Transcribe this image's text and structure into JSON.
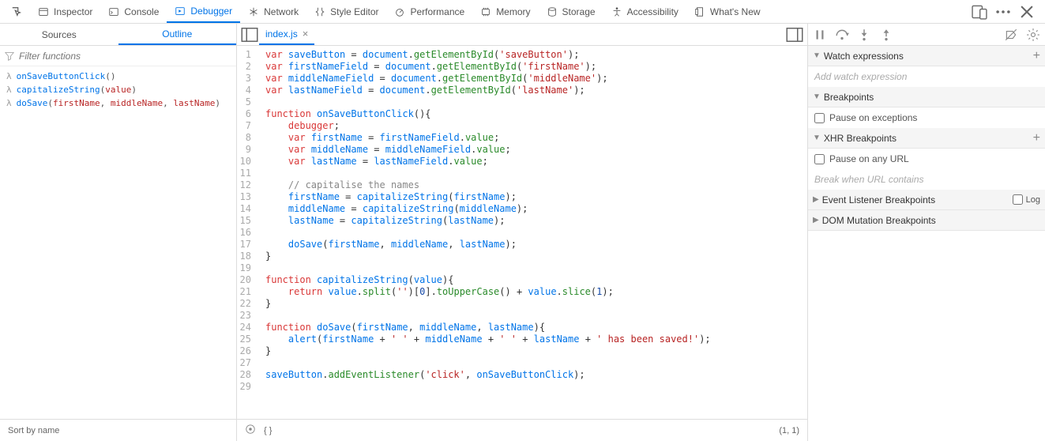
{
  "toolbar": {
    "tabs": [
      "Inspector",
      "Console",
      "Debugger",
      "Network",
      "Style Editor",
      "Performance",
      "Memory",
      "Storage",
      "Accessibility",
      "What's New"
    ],
    "active": 2
  },
  "leftPanel": {
    "tabs": [
      "Sources",
      "Outline"
    ],
    "active": 1,
    "filter_placeholder": "Filter functions",
    "outline": [
      {
        "name": "onSaveButtonClick",
        "params": []
      },
      {
        "name": "capitalizeString",
        "params": [
          "value"
        ]
      },
      {
        "name": "doSave",
        "params": [
          "firstName",
          "middleName",
          "lastName"
        ]
      }
    ],
    "footer": "Sort by name"
  },
  "editor": {
    "filename": "index.js",
    "cursor": "(1, 1)",
    "pretty": "{ }",
    "lines": 29,
    "source": [
      [
        [
          "kw",
          "var"
        ],
        [
          "sp",
          " "
        ],
        [
          "def",
          "saveButton"
        ],
        [
          "sp",
          " "
        ],
        [
          "op",
          "="
        ],
        [
          "sp",
          " "
        ],
        [
          "var2",
          "document"
        ],
        [
          "op",
          "."
        ],
        [
          "prop",
          "getElementById"
        ],
        [
          "op",
          "("
        ],
        [
          "str",
          "'saveButton'"
        ],
        [
          "op",
          ");"
        ]
      ],
      [
        [
          "kw",
          "var"
        ],
        [
          "sp",
          " "
        ],
        [
          "def",
          "firstNameField"
        ],
        [
          "sp",
          " "
        ],
        [
          "op",
          "="
        ],
        [
          "sp",
          " "
        ],
        [
          "var2",
          "document"
        ],
        [
          "op",
          "."
        ],
        [
          "prop",
          "getElementById"
        ],
        [
          "op",
          "("
        ],
        [
          "str",
          "'firstName'"
        ],
        [
          "op",
          ");"
        ]
      ],
      [
        [
          "kw",
          "var"
        ],
        [
          "sp",
          " "
        ],
        [
          "def",
          "middleNameField"
        ],
        [
          "sp",
          " "
        ],
        [
          "op",
          "="
        ],
        [
          "sp",
          " "
        ],
        [
          "var2",
          "document"
        ],
        [
          "op",
          "."
        ],
        [
          "prop",
          "getElementById"
        ],
        [
          "op",
          "("
        ],
        [
          "str",
          "'middleName'"
        ],
        [
          "op",
          ");"
        ]
      ],
      [
        [
          "kw",
          "var"
        ],
        [
          "sp",
          " "
        ],
        [
          "def",
          "lastNameField"
        ],
        [
          "sp",
          " "
        ],
        [
          "op",
          "="
        ],
        [
          "sp",
          " "
        ],
        [
          "var2",
          "document"
        ],
        [
          "op",
          "."
        ],
        [
          "prop",
          "getElementById"
        ],
        [
          "op",
          "("
        ],
        [
          "str",
          "'lastName'"
        ],
        [
          "op",
          ");"
        ]
      ],
      [],
      [
        [
          "kw",
          "function"
        ],
        [
          "sp",
          " "
        ],
        [
          "def",
          "onSaveButtonClick"
        ],
        [
          "op",
          "(){"
        ]
      ],
      [
        [
          "sp",
          "    "
        ],
        [
          "kw",
          "debugger"
        ],
        [
          "op",
          ";"
        ]
      ],
      [
        [
          "sp",
          "    "
        ],
        [
          "kw",
          "var"
        ],
        [
          "sp",
          " "
        ],
        [
          "def",
          "firstName"
        ],
        [
          "sp",
          " "
        ],
        [
          "op",
          "="
        ],
        [
          "sp",
          " "
        ],
        [
          "var2",
          "firstNameField"
        ],
        [
          "op",
          "."
        ],
        [
          "prop",
          "value"
        ],
        [
          "op",
          ";"
        ]
      ],
      [
        [
          "sp",
          "    "
        ],
        [
          "kw",
          "var"
        ],
        [
          "sp",
          " "
        ],
        [
          "def",
          "middleName"
        ],
        [
          "sp",
          " "
        ],
        [
          "op",
          "="
        ],
        [
          "sp",
          " "
        ],
        [
          "var2",
          "middleNameField"
        ],
        [
          "op",
          "."
        ],
        [
          "prop",
          "value"
        ],
        [
          "op",
          ";"
        ]
      ],
      [
        [
          "sp",
          "    "
        ],
        [
          "kw",
          "var"
        ],
        [
          "sp",
          " "
        ],
        [
          "def",
          "lastName"
        ],
        [
          "sp",
          " "
        ],
        [
          "op",
          "="
        ],
        [
          "sp",
          " "
        ],
        [
          "var2",
          "lastNameField"
        ],
        [
          "op",
          "."
        ],
        [
          "prop",
          "value"
        ],
        [
          "op",
          ";"
        ]
      ],
      [],
      [
        [
          "sp",
          "    "
        ],
        [
          "com",
          "// capitalise the names"
        ]
      ],
      [
        [
          "sp",
          "    "
        ],
        [
          "var2",
          "firstName"
        ],
        [
          "sp",
          " "
        ],
        [
          "op",
          "="
        ],
        [
          "sp",
          " "
        ],
        [
          "var2",
          "capitalizeString"
        ],
        [
          "op",
          "("
        ],
        [
          "var2",
          "firstName"
        ],
        [
          "op",
          ");"
        ]
      ],
      [
        [
          "sp",
          "    "
        ],
        [
          "var2",
          "middleName"
        ],
        [
          "sp",
          " "
        ],
        [
          "op",
          "="
        ],
        [
          "sp",
          " "
        ],
        [
          "var2",
          "capitalizeString"
        ],
        [
          "op",
          "("
        ],
        [
          "var2",
          "middleName"
        ],
        [
          "op",
          ");"
        ]
      ],
      [
        [
          "sp",
          "    "
        ],
        [
          "var2",
          "lastName"
        ],
        [
          "sp",
          " "
        ],
        [
          "op",
          "="
        ],
        [
          "sp",
          " "
        ],
        [
          "var2",
          "capitalizeString"
        ],
        [
          "op",
          "("
        ],
        [
          "var2",
          "lastName"
        ],
        [
          "op",
          ");"
        ]
      ],
      [],
      [
        [
          "sp",
          "    "
        ],
        [
          "var2",
          "doSave"
        ],
        [
          "op",
          "("
        ],
        [
          "var2",
          "firstName"
        ],
        [
          "op",
          ", "
        ],
        [
          "var2",
          "middleName"
        ],
        [
          "op",
          ", "
        ],
        [
          "var2",
          "lastName"
        ],
        [
          "op",
          ");"
        ]
      ],
      [
        [
          "op",
          "}"
        ]
      ],
      [],
      [
        [
          "kw",
          "function"
        ],
        [
          "sp",
          " "
        ],
        [
          "def",
          "capitalizeString"
        ],
        [
          "op",
          "("
        ],
        [
          "def",
          "value"
        ],
        [
          "op",
          "){"
        ]
      ],
      [
        [
          "sp",
          "    "
        ],
        [
          "kw",
          "return"
        ],
        [
          "sp",
          " "
        ],
        [
          "var2",
          "value"
        ],
        [
          "op",
          "."
        ],
        [
          "prop",
          "split"
        ],
        [
          "op",
          "("
        ],
        [
          "str",
          "''"
        ],
        [
          "op",
          ")["
        ],
        [
          "num",
          "0"
        ],
        [
          "op",
          "]."
        ],
        [
          "prop",
          "toUpperCase"
        ],
        [
          "op",
          "() + "
        ],
        [
          "var2",
          "value"
        ],
        [
          "op",
          "."
        ],
        [
          "prop",
          "slice"
        ],
        [
          "op",
          "("
        ],
        [
          "num",
          "1"
        ],
        [
          "op",
          ");"
        ]
      ],
      [
        [
          "op",
          "}"
        ]
      ],
      [],
      [
        [
          "kw",
          "function"
        ],
        [
          "sp",
          " "
        ],
        [
          "def",
          "doSave"
        ],
        [
          "op",
          "("
        ],
        [
          "def",
          "firstName"
        ],
        [
          "op",
          ", "
        ],
        [
          "def",
          "middleName"
        ],
        [
          "op",
          ", "
        ],
        [
          "def",
          "lastName"
        ],
        [
          "op",
          "){"
        ]
      ],
      [
        [
          "sp",
          "    "
        ],
        [
          "var2",
          "alert"
        ],
        [
          "op",
          "("
        ],
        [
          "var2",
          "firstName"
        ],
        [
          "sp",
          " "
        ],
        [
          "op",
          "+"
        ],
        [
          "sp",
          " "
        ],
        [
          "str",
          "' '"
        ],
        [
          "sp",
          " "
        ],
        [
          "op",
          "+"
        ],
        [
          "sp",
          " "
        ],
        [
          "var2",
          "middleName"
        ],
        [
          "sp",
          " "
        ],
        [
          "op",
          "+"
        ],
        [
          "sp",
          " "
        ],
        [
          "str",
          "' '"
        ],
        [
          "sp",
          " "
        ],
        [
          "op",
          "+"
        ],
        [
          "sp",
          " "
        ],
        [
          "var2",
          "lastName"
        ],
        [
          "sp",
          " "
        ],
        [
          "op",
          "+"
        ],
        [
          "sp",
          " "
        ],
        [
          "str",
          "' has been saved!'"
        ],
        [
          "op",
          ");"
        ]
      ],
      [
        [
          "op",
          "}"
        ]
      ],
      [],
      [
        [
          "var2",
          "saveButton"
        ],
        [
          "op",
          "."
        ],
        [
          "prop",
          "addEventListener"
        ],
        [
          "op",
          "("
        ],
        [
          "str",
          "'click'"
        ],
        [
          "op",
          ", "
        ],
        [
          "var2",
          "onSaveButtonClick"
        ],
        [
          "op",
          ");"
        ]
      ],
      []
    ]
  },
  "rightPanel": {
    "sections": {
      "watch": {
        "title": "Watch expressions",
        "placeholder": "Add watch expression"
      },
      "breakpoints": {
        "title": "Breakpoints",
        "pause_exceptions": "Pause on exceptions"
      },
      "xhr": {
        "title": "XHR Breakpoints",
        "pause_any_url": "Pause on any URL",
        "placeholder": "Break when URL contains"
      },
      "event": {
        "title": "Event Listener Breakpoints",
        "log_label": "Log"
      },
      "dom": {
        "title": "DOM Mutation Breakpoints"
      }
    }
  }
}
